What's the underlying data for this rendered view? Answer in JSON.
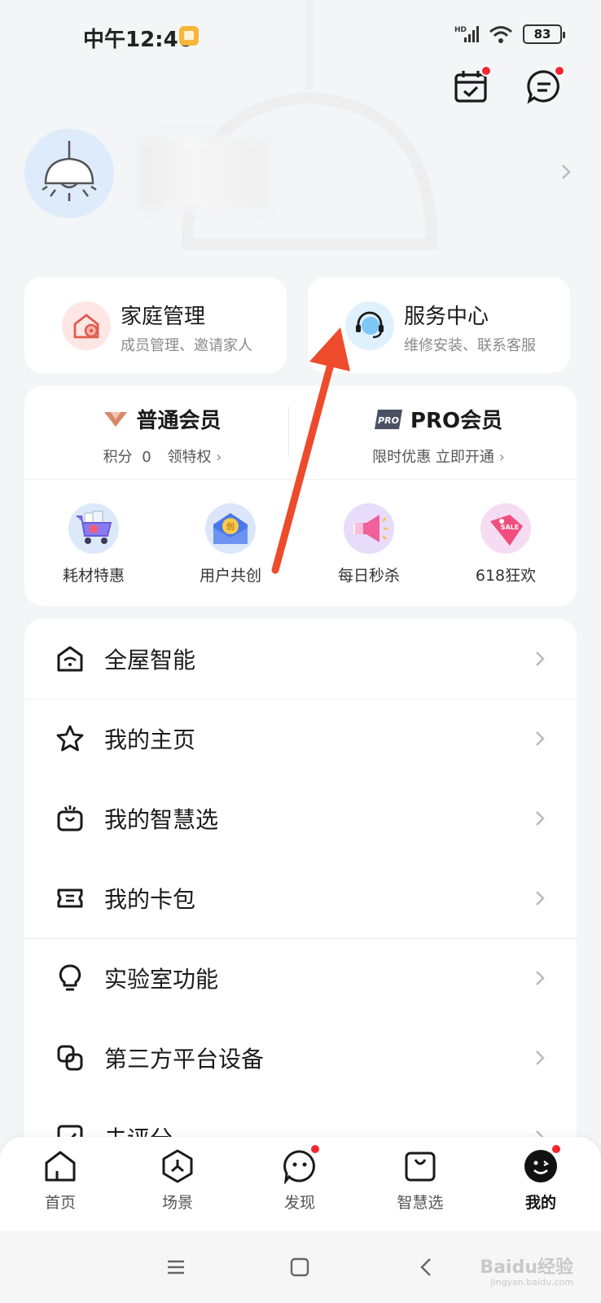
{
  "status": {
    "time": "中午12:46",
    "network": "HD",
    "battery": "83"
  },
  "header": {
    "calendar_icon": "calendar-check-icon",
    "message_icon": "message-icon"
  },
  "features": [
    {
      "title": "家庭管理",
      "subtitle": "成员管理、邀请家人",
      "icon": "home-gear-icon",
      "color": "#fde6e3"
    },
    {
      "title": "服务中心",
      "subtitle": "维修安装、联系客服",
      "icon": "headset-icon",
      "color": "#dff1fc"
    }
  ],
  "membership": {
    "regular": {
      "title": "普通会员",
      "points_label": "积分",
      "points": "0",
      "privilege": "领特权"
    },
    "pro": {
      "badge": "PRO",
      "title": "PRO会员",
      "promo": "限时优惠 立即开通"
    }
  },
  "perks": [
    {
      "label": "耗材特惠",
      "icon": "cart-icon"
    },
    {
      "label": "用户共创",
      "icon": "envelope-icon",
      "badge": "创"
    },
    {
      "label": "每日秒杀",
      "icon": "megaphone-icon"
    },
    {
      "label": "618狂欢",
      "icon": "sale-tag-icon",
      "badge": "SALE"
    }
  ],
  "menu": [
    {
      "label": "全屋智能",
      "icon": "smart-home-icon"
    },
    {
      "label": "我的主页",
      "icon": "star-icon"
    },
    {
      "label": "我的智慧选",
      "icon": "shopping-bag-icon"
    },
    {
      "label": "我的卡包",
      "icon": "ticket-icon"
    },
    {
      "label": "实验室功能",
      "icon": "lightbulb-icon"
    },
    {
      "label": "第三方平台设备",
      "icon": "link-icon"
    },
    {
      "label": "去评分",
      "icon": "rate-icon"
    }
  ],
  "tabs": [
    {
      "label": "首页",
      "icon": "home-icon",
      "active": false
    },
    {
      "label": "场景",
      "icon": "scene-icon",
      "active": false
    },
    {
      "label": "发现",
      "icon": "discover-icon",
      "active": false,
      "dot": true
    },
    {
      "label": "智慧选",
      "icon": "shop-icon",
      "active": false
    },
    {
      "label": "我的",
      "icon": "profile-icon",
      "active": true,
      "dot": true
    }
  ],
  "watermark": {
    "text": "Baidu经验",
    "sub": "jingyan.baidu.com"
  },
  "colors": {
    "accent_red": "#f4262e",
    "annotation_arrow": "#ee4a2c"
  }
}
